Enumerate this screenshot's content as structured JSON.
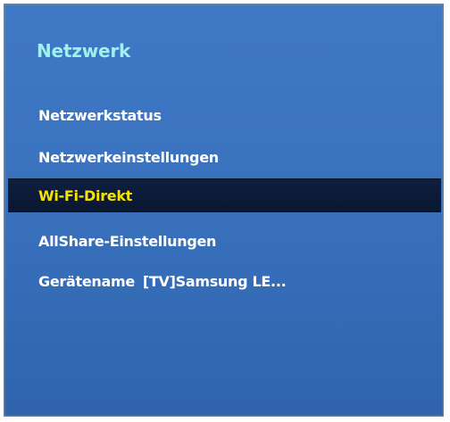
{
  "menu": {
    "title": "Netzwerk",
    "items": [
      {
        "label": "Netzwerkstatus"
      },
      {
        "label": "Netzwerkeinstellungen"
      },
      {
        "label": "Wi-Fi-Direkt",
        "selected": true
      },
      {
        "label": "AllShare-Einstellungen"
      },
      {
        "label": "Gerätename",
        "value": "[TV]Samsung LE..."
      }
    ]
  },
  "colors": {
    "panel_background": "#3a72be",
    "title_text": "#9df2ea",
    "item_text": "#ffffff",
    "selected_background": "#0e1f3f",
    "selected_text": "#f6e300"
  }
}
